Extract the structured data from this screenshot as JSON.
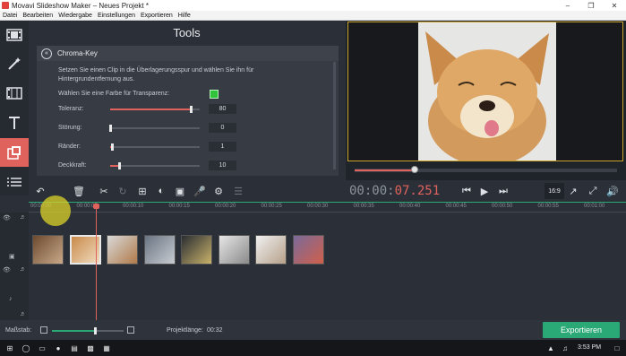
{
  "window": {
    "title": "Movavi Slideshow Maker – Neues Projekt *"
  },
  "menu": {
    "items": [
      "Datei",
      "Bearbeiten",
      "Wiedergabe",
      "Einstellungen",
      "Exportieren",
      "Hilfe"
    ]
  },
  "left_tools": [
    {
      "icon": "film-icon"
    },
    {
      "icon": "magic-wand-icon"
    },
    {
      "icon": "filmstrip-icon"
    },
    {
      "icon": "text-icon"
    },
    {
      "icon": "overlay-icon",
      "active": true
    },
    {
      "icon": "menu-lines-icon"
    }
  ],
  "tools_panel": {
    "title": "Tools",
    "chroma_key": {
      "title": "Chroma-Key",
      "description": "Setzen Sie einen Clip in die Überlagerungsspur und wählen Sie ihn für Hintergrundentfernung aus.",
      "color_label": "Wählen Sie eine Farbe für Transparenz:",
      "color": "#2fc43a",
      "sliders": [
        {
          "label": "Toleranz:",
          "value": "80",
          "fraction": 0.9
        },
        {
          "label": "Störung:",
          "value": "0",
          "fraction": 0.0
        },
        {
          "label": "Ränder:",
          "value": "1",
          "fraction": 0.02
        },
        {
          "label": "Deckkraft:",
          "value": "10",
          "fraction": 0.1
        }
      ]
    }
  },
  "preview": {
    "seek_progress": 0.23
  },
  "toolbar": {
    "timecode_main": "00:00:",
    "timecode_ms": "07.251",
    "aspect_ratio": "16:9"
  },
  "timeline": {
    "ticks": [
      "00:00:00",
      "00:00:05",
      "00:00:10",
      "00:00:15",
      "00:00:20",
      "00:00:25",
      "00:00:30",
      "00:00:35",
      "00:00:40",
      "00:00:45",
      "00:00:50",
      "00:00:55",
      "00:01:00"
    ],
    "clips": [
      {
        "kind": "family",
        "colors": [
          "#6b4a2e",
          "#c9a98a"
        ]
      },
      {
        "kind": "dog",
        "colors": [
          "#c98a4a",
          "#f0dcc0"
        ],
        "selected": true
      },
      {
        "kind": "puppies",
        "colors": [
          "#d9d9d9",
          "#b07a4a"
        ]
      },
      {
        "kind": "cat",
        "colors": [
          "#6a7482",
          "#c8ccd2"
        ]
      },
      {
        "kind": "dark",
        "colors": [
          "#2a2d33",
          "#c8b26a"
        ]
      },
      {
        "kind": "people",
        "colors": [
          "#e6e6e6",
          "#8a8a8a"
        ]
      },
      {
        "kind": "kitten",
        "colors": [
          "#f0f0f0",
          "#b5a08a"
        ]
      },
      {
        "kind": "group",
        "colors": [
          "#7a6a9a",
          "#d0604a"
        ]
      }
    ]
  },
  "bottom": {
    "scale_label": "Maßstab:",
    "zoom_fraction": 0.6,
    "project_length_label": "Projektlänge:",
    "project_length_value": "00:32",
    "export_label": "Exportieren"
  },
  "taskbar": {
    "time": "3:53 PM"
  }
}
